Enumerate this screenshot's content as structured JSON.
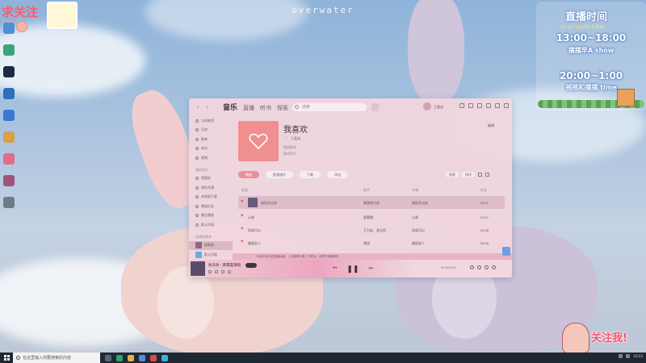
{
  "wallpaper": {
    "title": "overwater"
  },
  "overlay": {
    "follow_text": "求关注",
    "schedule": {
      "title": "直播时间",
      "subtitle": "ya ya youdo tuber",
      "slot1_time": "13:00~18:00",
      "slot1_name": "摆摆早A show",
      "slot2_time": "20:00~1:00",
      "slot2_name": "摇摇和摆摆 time"
    },
    "streamer_text": "关注我!"
  },
  "app": {
    "tabs": [
      "音乐",
      "直播",
      "听书",
      "探索"
    ],
    "active_tab": 0,
    "search_placeholder": "搜索",
    "user_name": "王嘉诚",
    "sidebar": {
      "items": [
        "为你推荐",
        "乐库",
        "歌单",
        "电台",
        "视频"
      ],
      "my_music_label": "我的音乐",
      "my_items": [
        "我喜欢",
        "我的专辑",
        "本地和下载",
        "播放历史",
        "最近播放",
        "默认列表"
      ],
      "created_label": "创建的歌单",
      "playlists": [
        "睡眠歌",
        "默认列表"
      ]
    },
    "playlist": {
      "title": "我喜欢",
      "owner": "王嘉诚",
      "meta1": "播放歌单",
      "meta2": "歌单简介",
      "edit_label": "编辑",
      "actions": [
        "播放",
        "批量操作",
        "下载",
        "添加"
      ],
      "right_actions": [
        "搜索",
        "排序"
      ]
    },
    "table": {
      "headers": [
        "歌曲",
        "歌手",
        "专辑",
        "时长"
      ],
      "rows": [
        {
          "title": "离别开出花",
          "artist": "就是南方凯",
          "album": "离别开出花",
          "duration": "03:31"
        },
        {
          "title": "心呢",
          "artist": "黄霄雲",
          "album": "心呢",
          "duration": "03:27"
        },
        {
          "title": "如若可以",
          "artist": "王力宏、苏见信",
          "album": "如若可以",
          "duration": "04:25"
        },
        {
          "title": "美国女人",
          "artist": "周深",
          "album": "美国女人",
          "duration": "03:18"
        }
      ]
    },
    "notice": "抖音平台开启直播功能，上线推荐与第三方联动，请遵守直播规范",
    "player": {
      "song": "秋天你 - 黄霄雲演唱",
      "time": "00:00/03:31"
    }
  },
  "taskbar": {
    "search_placeholder": "在这里输入你要搜索的内容",
    "clock": "10:22"
  },
  "colors": {
    "accent": "#e88f9d",
    "heart": "#e05a6e",
    "cover": "#ef8f8f",
    "taskbar": "#202833"
  }
}
